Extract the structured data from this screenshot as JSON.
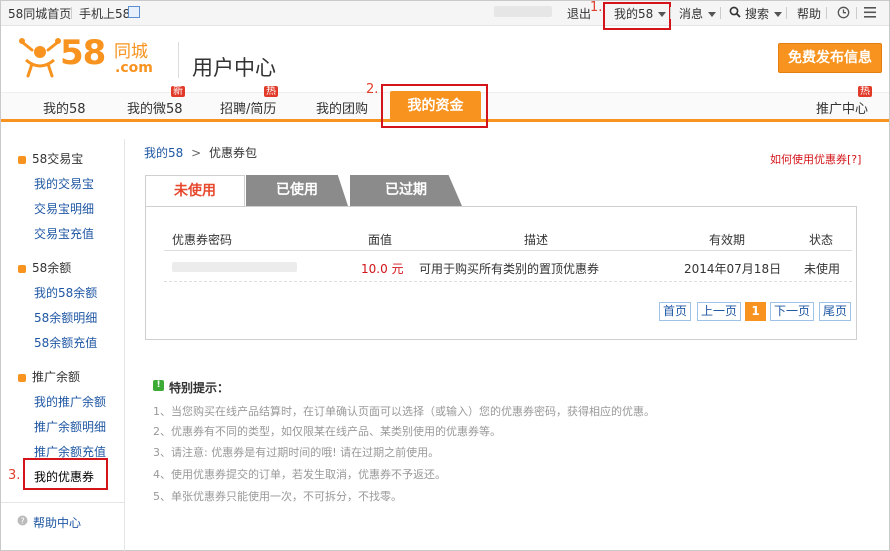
{
  "topbar": {
    "home": "58同城首页",
    "mobile": "手机上58",
    "username": "blurred-user",
    "logout": "退出",
    "my58": "我的58",
    "messages": "消息",
    "search": "搜索",
    "help": "帮助"
  },
  "steps": {
    "s1": "1.",
    "s2": "2.",
    "s3": "3."
  },
  "logo": {
    "word": "58",
    "cn": "同城",
    "dotcom": ".com"
  },
  "header": {
    "title": "用户中心",
    "publish": "免费发布信息"
  },
  "nav": {
    "my58": "我的58",
    "mywei58": "我的微58",
    "zhaopin": "招聘/简历",
    "tuangou": "我的团购",
    "zijin": "我的资金",
    "tuiguang": "推广中心",
    "badge_new": "新",
    "badge_hot": "热"
  },
  "sidebar": {
    "g1": "58交易宝",
    "g1_items": [
      "我的交易宝",
      "交易宝明细",
      "交易宝充值"
    ],
    "g2": "58余额",
    "g2_items": [
      "我的58余额",
      "58余额明细",
      "58余额充值"
    ],
    "g3": "推广余额",
    "g3_items": [
      "我的推广余额",
      "推广余额明细",
      "推广余额充值"
    ],
    "selected": "我的优惠券",
    "help": "帮助中心"
  },
  "breadcrumb": {
    "root": "我的58",
    "sep": ">",
    "current": "优惠券包"
  },
  "howto": "如何使用优惠券[?]",
  "tabs": [
    "未使用",
    "已使用",
    "已过期"
  ],
  "table": {
    "headers": [
      "优惠券密码",
      "面值",
      "描述",
      "有效期",
      "状态"
    ],
    "row": {
      "code": "blurred-coupon-code",
      "value": "10.0 元",
      "desc": "可用于购买所有类别的置顶优惠券",
      "expiry": "2014年07月18日",
      "status": "未使用"
    }
  },
  "pager": {
    "first": "首页",
    "prev": "上一页",
    "current": "1",
    "next": "下一页",
    "last": "尾页"
  },
  "tips": {
    "title": "特别提示：",
    "items": [
      "1、当您购买在线产品结算时，在订单确认页面可以选择（或输入）您的优惠券密码，获得相应的优惠。",
      "2、优惠券有不同的类型，如仅限某在线产品、某类别使用的优惠券等。",
      "3、请注意: 优惠券是有过期时间的哦! 请在过期之前使用。",
      "4、使用优惠券提交的订单，若发生取消，优惠券不予返还。",
      "5、单张优惠券只能使用一次，不可拆分，不找零。"
    ]
  },
  "colors": {
    "accent": "#f7931e",
    "highlight": "#d3141a",
    "link": "#1f57a3"
  }
}
